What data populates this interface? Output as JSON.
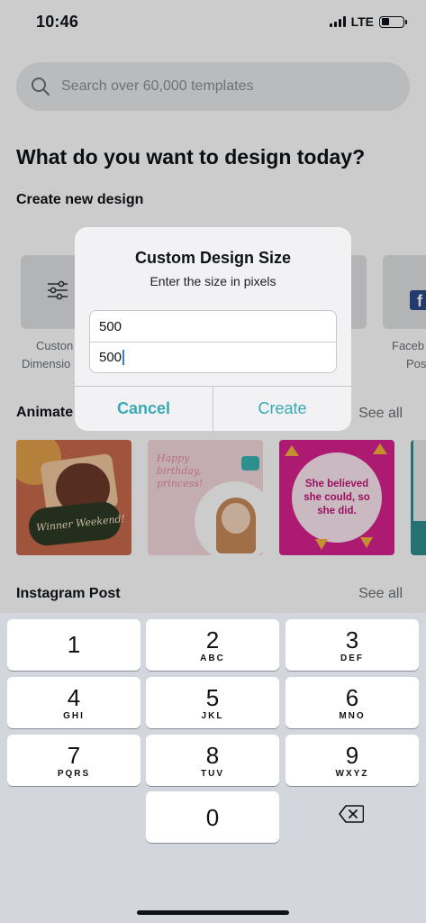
{
  "status": {
    "time": "10:46",
    "network": "LTE"
  },
  "search": {
    "placeholder": "Search over 60,000 templates"
  },
  "page_title": "What do you want to design today?",
  "create_section": {
    "title": "Create new design",
    "tiles": [
      {
        "label_line1": "Custon",
        "label_line2": "Dimensio",
        "icon": "sliders-icon"
      },
      {
        "label_line1": "Faceb",
        "label_line2": "Pos",
        "icon": "facebook-icon"
      }
    ]
  },
  "animated_section": {
    "title": "Animate",
    "see_all": "See all",
    "thumbnails": [
      {
        "text": "Winner Weekend!",
        "color": "#c7694a"
      },
      {
        "text": "Happy birthday, princess!",
        "color": "#f4c6cf"
      },
      {
        "text": "She believed she could, so she did.",
        "color": "#d8218e"
      }
    ]
  },
  "instagram_section": {
    "title": "Instagram Post",
    "see_all": "See all"
  },
  "dialog": {
    "title": "Custom Design Size",
    "message": "Enter the size in pixels",
    "width_value": "500",
    "height_value": "500",
    "cancel_label": "Cancel",
    "create_label": "Create",
    "accent_color": "#37a9b5"
  },
  "keyboard": {
    "keys": [
      {
        "digit": "1",
        "letters": ""
      },
      {
        "digit": "2",
        "letters": "ABC"
      },
      {
        "digit": "3",
        "letters": "DEF"
      },
      {
        "digit": "4",
        "letters": "GHI"
      },
      {
        "digit": "5",
        "letters": "JKL"
      },
      {
        "digit": "6",
        "letters": "MNO"
      },
      {
        "digit": "7",
        "letters": "PQRS"
      },
      {
        "digit": "8",
        "letters": "TUV"
      },
      {
        "digit": "9",
        "letters": "WXYZ"
      },
      {
        "digit": "0",
        "letters": ""
      }
    ],
    "delete_icon": "backspace-icon"
  }
}
